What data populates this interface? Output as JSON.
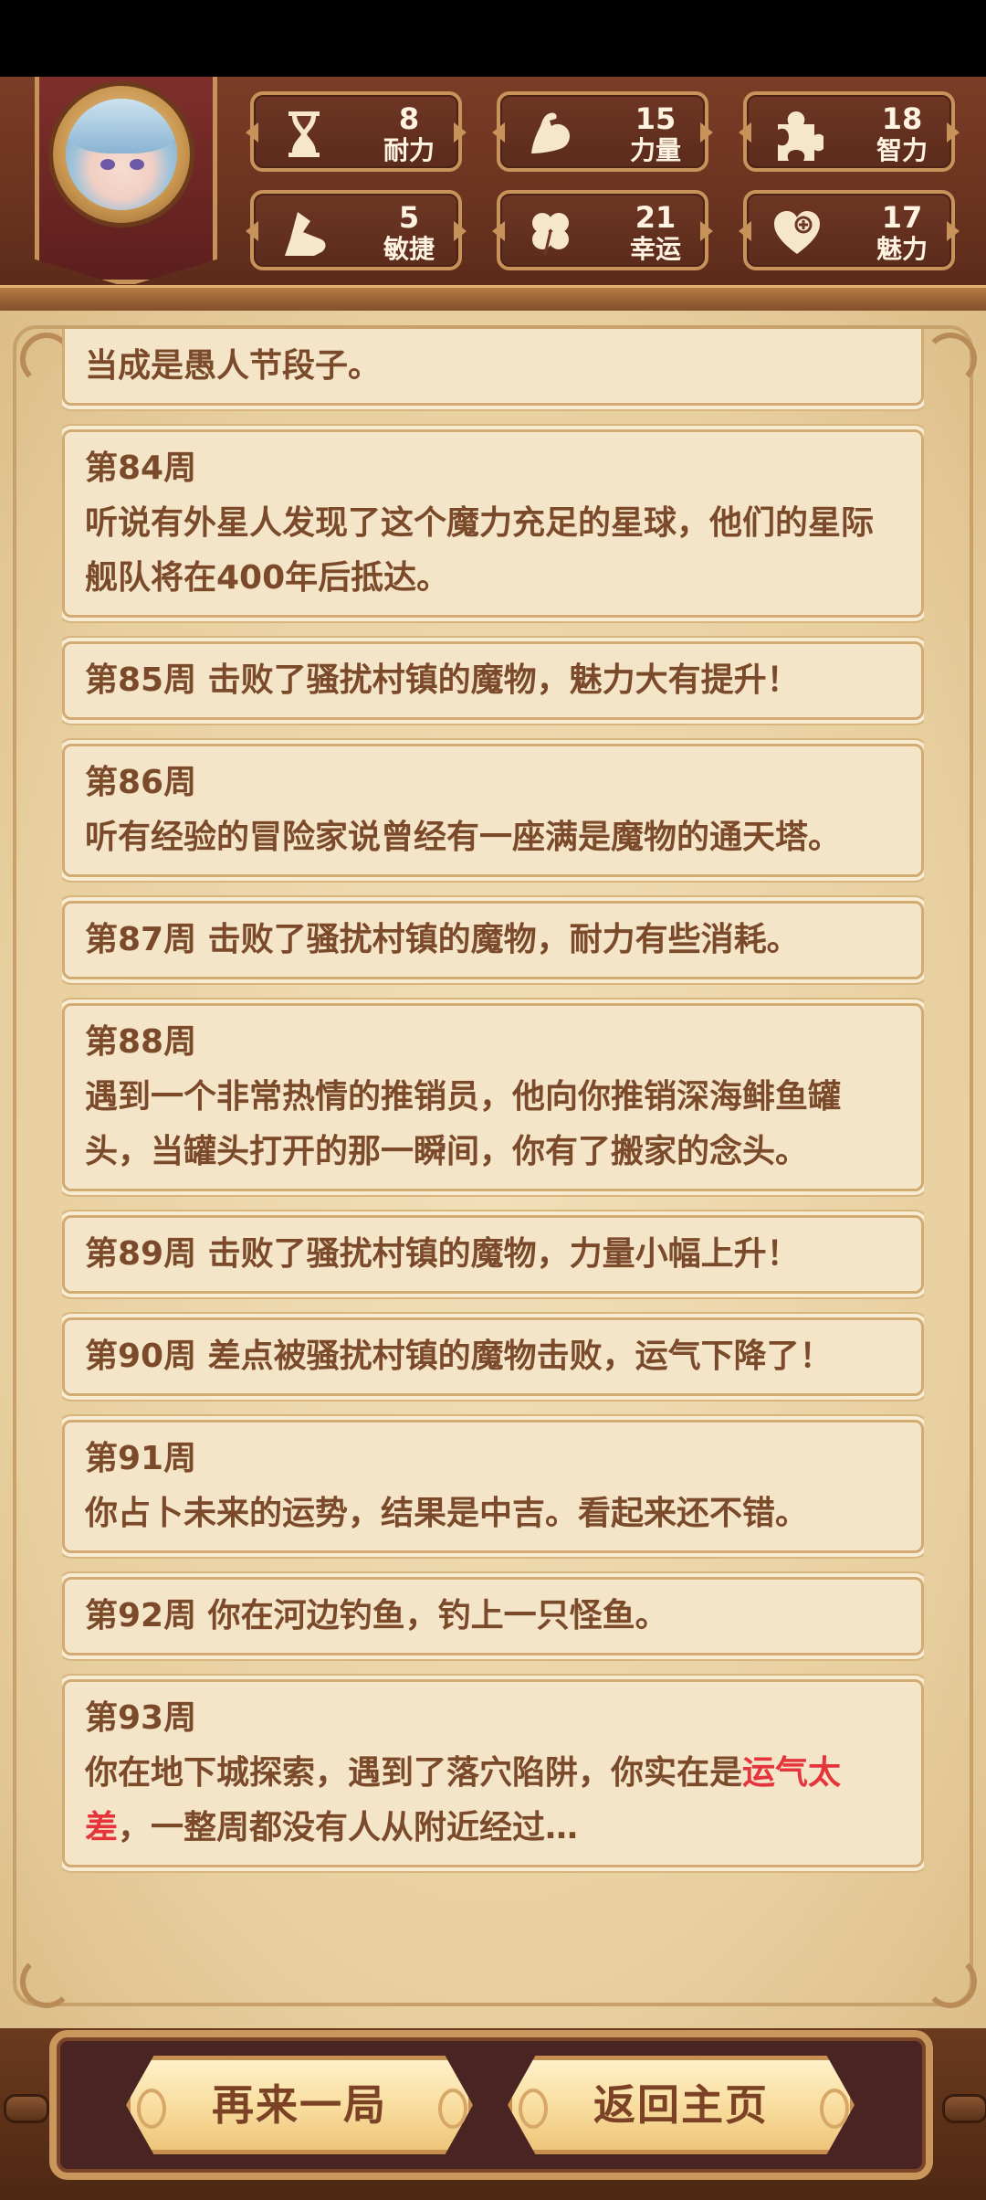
{
  "header": {
    "stats": [
      {
        "label": "耐力",
        "value": "8",
        "icon": "hourglass-icon"
      },
      {
        "label": "力量",
        "value": "15",
        "icon": "muscle-arm-icon"
      },
      {
        "label": "智力",
        "value": "18",
        "icon": "puzzle-piece-icon"
      },
      {
        "label": "敏捷",
        "value": "5",
        "icon": "boot-icon"
      },
      {
        "label": "幸运",
        "value": "21",
        "icon": "four-leaf-clover-icon"
      },
      {
        "label": "魅力",
        "value": "17",
        "icon": "heart-plus-icon"
      }
    ]
  },
  "log": {
    "partial_top": "当成是愚人节段子。",
    "entries": [
      {
        "week": "第84周",
        "text": "听说有外星人发现了这个魔力充足的星球，他们的星际舰队将在400年后抵达。"
      },
      {
        "week": "第85周",
        "text": "击败了骚扰村镇的魔物，魅力大有提升！"
      },
      {
        "week": "第86周",
        "text": "听有经验的冒险家说曾经有一座满是魔物的通天塔。"
      },
      {
        "week": "第87周",
        "text": "击败了骚扰村镇的魔物，耐力有些消耗。"
      },
      {
        "week": "第88周",
        "text": "遇到一个非常热情的推销员，他向你推销深海鲱鱼罐头，当罐头打开的那一瞬间，你有了搬家的念头。"
      },
      {
        "week": "第89周",
        "text": "击败了骚扰村镇的魔物，力量小幅上升！"
      },
      {
        "week": "第90周",
        "text": "差点被骚扰村镇的魔物击败，运气下降了！"
      },
      {
        "week": "第91周",
        "text": "你占卜未来的运势，结果是中吉。看起来还不错。"
      },
      {
        "week": "第92周",
        "text": "你在河边钓鱼，钓上一只怪鱼。"
      },
      {
        "week": "第93周",
        "text_before": "你在地下城探索，遇到了落穴陷阱，你实在是",
        "text_highlight": "运气太差",
        "text_after": "，一整周都没有人从附近经过…"
      }
    ]
  },
  "buttons": {
    "restart": "再来一局",
    "home": "返回主页"
  },
  "colors": {
    "highlight": "#e5343c",
    "text": "#7b4a2b",
    "parchment": "#f4e5c8"
  }
}
